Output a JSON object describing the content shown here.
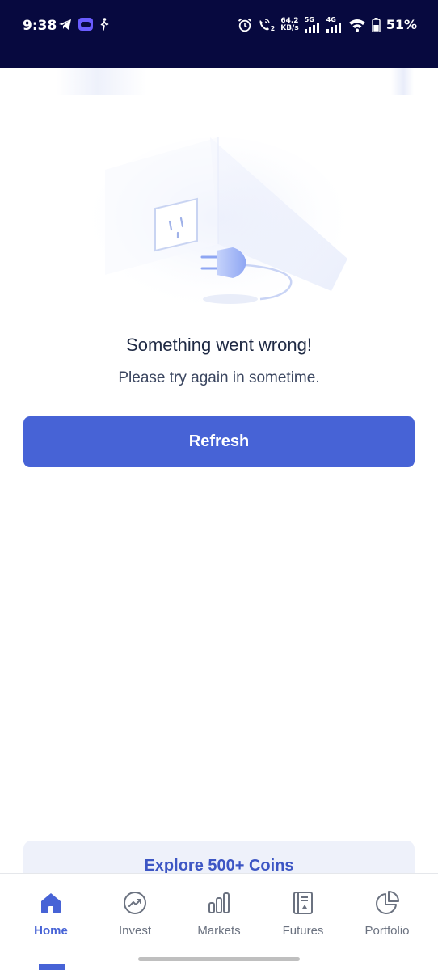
{
  "status_bar": {
    "time": "9:38",
    "net_speed_value": "64.2",
    "net_speed_unit": "KB/s",
    "sim1_label": "5G",
    "sim2_label": "4G",
    "call_badge": "2",
    "battery_percent": "51%"
  },
  "error": {
    "title": "Something went wrong!",
    "subtitle": "Please try again in sometime.",
    "refresh_label": "Refresh"
  },
  "explore_banner": {
    "label": "Explore 500+ Coins"
  },
  "bottom_nav": {
    "items": [
      {
        "label": "Home",
        "icon": "home-icon",
        "active": true
      },
      {
        "label": "Invest",
        "icon": "trending-up-icon",
        "active": false
      },
      {
        "label": "Markets",
        "icon": "bar-chart-icon",
        "active": false
      },
      {
        "label": "Futures",
        "icon": "document-chart-icon",
        "active": false
      },
      {
        "label": "Portfolio",
        "icon": "pie-chart-icon",
        "active": false
      }
    ]
  },
  "colors": {
    "status_bar_bg": "#07093f",
    "accent": "#4763d6",
    "banner_bg": "#eef1fa"
  }
}
